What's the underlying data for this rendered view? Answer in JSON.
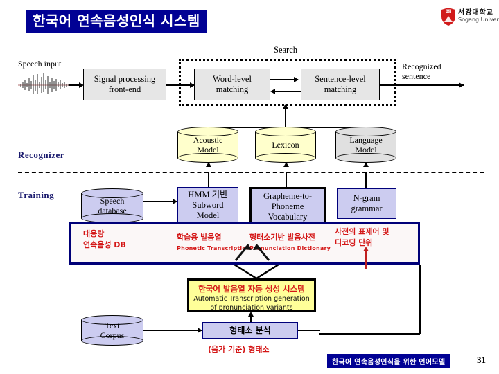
{
  "title": "한국어 연속음성인식 시스템",
  "logo": {
    "korean": "서강대학교",
    "english": "Sogang University"
  },
  "labels": {
    "search": "Search",
    "speech_input": "Speech input",
    "recognized_sentence_line1": "Recognized",
    "recognized_sentence_line2": "sentence",
    "recognizer": "Recognizer",
    "training": "Training"
  },
  "recognizer": {
    "front_end": "Signal processing\nfront-end",
    "front_end_line1": "Signal processing",
    "front_end_line2": "front-end",
    "word_matching_line1": "Word-level",
    "word_matching_line2": "matching",
    "sentence_matching_line1": "Sentence-level",
    "sentence_matching_line2": "matching",
    "models": [
      {
        "line1": "Acoustic",
        "line2": "Model",
        "fill": "#ffffcc"
      },
      {
        "line1": "Lexicon",
        "line2": "",
        "fill": "#ffffcc"
      },
      {
        "line1": "Language",
        "line2": "Model",
        "fill": "#e0e0e0"
      }
    ]
  },
  "training": {
    "speech_db_line1": "Speech",
    "speech_db_line2": "database",
    "hmm_line1": "HMM 기반",
    "hmm_line2": "Subword",
    "hmm_line3": "Model",
    "g2p_line1": "Grapheme-to-",
    "g2p_line2": "Phoneme",
    "g2p_line3": "Vocabulary",
    "ngram_line1": "N-gram",
    "ngram_line2": "grammar",
    "annotations": [
      {
        "ko1": "대용량",
        "ko2": "연속음성 DB",
        "en": ""
      },
      {
        "ko1": "학습용 발음열",
        "ko2": "",
        "en": "Phonetic Transcription"
      },
      {
        "ko1": "형태소기반 발음사전",
        "ko2": "",
        "en": "Pronunciation Dictionary"
      },
      {
        "ko1": "사전의 표제어 및",
        "ko2": "디코딩 단위",
        "en": ""
      }
    ]
  },
  "bottom": {
    "auto_trans_ko": "한국어 발음열 자동 생성 시스템",
    "auto_trans_en1": "Automatic Transcription generation",
    "auto_trans_en2": "of pronunciation variants",
    "text_corpus_line1": "Text",
    "text_corpus_line2": "Corpus",
    "morph_analysis": "형태소 분석",
    "morph_note": "(음가 기준) 형태소"
  },
  "footer": {
    "banner": "한국어 연속음성인식을 위한 언어모델",
    "page": "31"
  },
  "colors": {
    "title_bg": "#010194",
    "model_yellow": "#ffffcc",
    "model_gray": "#e0e0e0",
    "training_lavender": "#ccccf0",
    "annotation_red": "#d41616",
    "highlight_yellow": "#ffff99",
    "process_gray": "#e6e6e6"
  }
}
